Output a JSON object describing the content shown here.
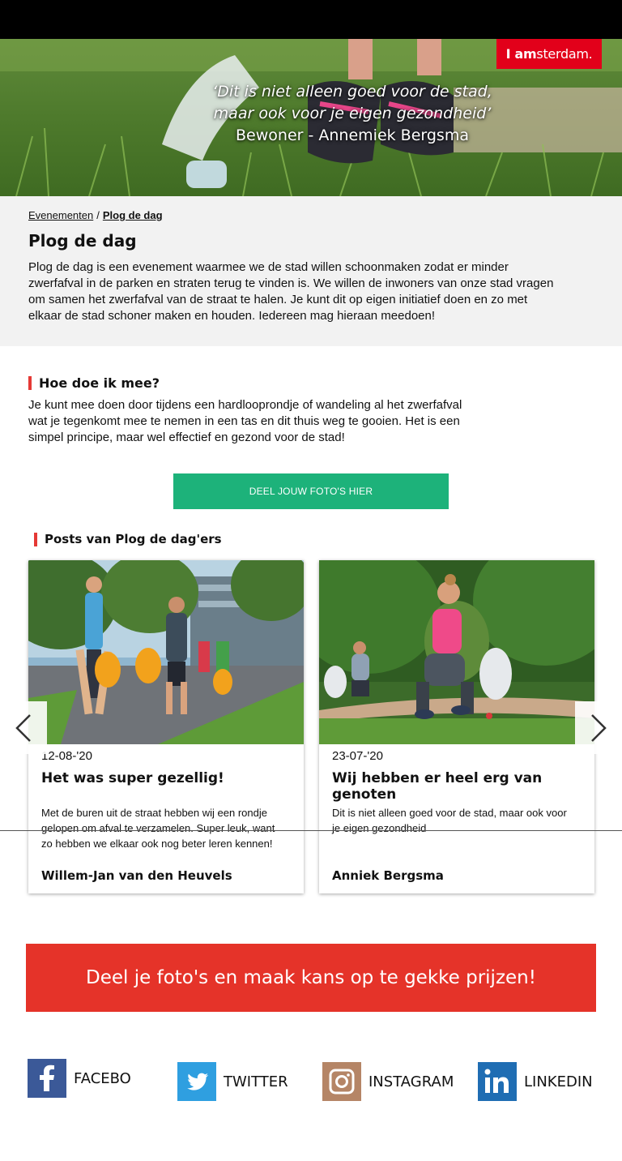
{
  "hero": {
    "quote_line1": "‘Dit is niet alleen goed voor de stad,",
    "quote_line2": "maar ook voor je eigen gezondheid’",
    "quote_author": "Bewoner - Annemiek Bergsma",
    "logo_prefix": "I am",
    "logo_rest": "sterdam."
  },
  "breadcrumb": {
    "parent": "Evenementen",
    "separator": "/",
    "current": "Plog de dag"
  },
  "intro": {
    "title": "Plog de dag",
    "text": "Plog de dag is een evenement waarmee we de stad willen schoonmaken zodat er minder zwerfafval in de parken en straten terug te vinden is. We willen de inwoners van onze stad vragen om samen het zwerfafval van de straat te halen. Je kunt dit op eigen initiatief doen en zo met elkaar de stad schoner maken en houden. Iedereen mag hieraan meedoen!"
  },
  "how": {
    "heading": "Hoe doe ik mee?",
    "text": "Je kunt mee doen door tijdens een hardlooprondje of wandeling al het zwerfafval wat je tegenkomt mee te nemen in een tas en dit thuis weg te gooien. Het is een simpel principe, maar wel effectief en gezond voor de stad!"
  },
  "share_button": "DEEL JOUW FOTO'S HIER",
  "posts": {
    "heading": "Posts van Plog de dag'ers",
    "items": [
      {
        "date": "12-08-'20",
        "title": "Het was super gezellig!",
        "text": "Met de buren uit de straat hebben wij een rondje gelopen om afval te verzamelen. Super leuk, want zo hebben we elkaar ook nog beter leren kennen!",
        "author": "Willem-Jan van den Heuvels"
      },
      {
        "date": "23-07-'20",
        "title": "Wij hebben er heel erg van genoten",
        "text": "Dit is niet alleen goed voor de stad, maar ook voor je eigen gezondheid",
        "author": "Anniek Bergsma"
      }
    ]
  },
  "prize_banner": "Deel je foto's en maak kans op te gekke prijzen!",
  "social": {
    "facebook": "FACEBO",
    "twitter": "TWITTER",
    "instagram": "INSTAGRAM",
    "linkedin": "LINKEDIN"
  },
  "colors": {
    "accent_red": "#e53329",
    "green_button": "#1db27a",
    "facebook": "#3b5998",
    "twitter": "#2f9fe0",
    "instagram": "#b58566",
    "linkedin": "#1f6db3"
  },
  "icons": [
    "chevron-left-icon",
    "chevron-right-icon",
    "facebook-icon",
    "twitter-icon",
    "instagram-icon",
    "linkedin-icon"
  ]
}
